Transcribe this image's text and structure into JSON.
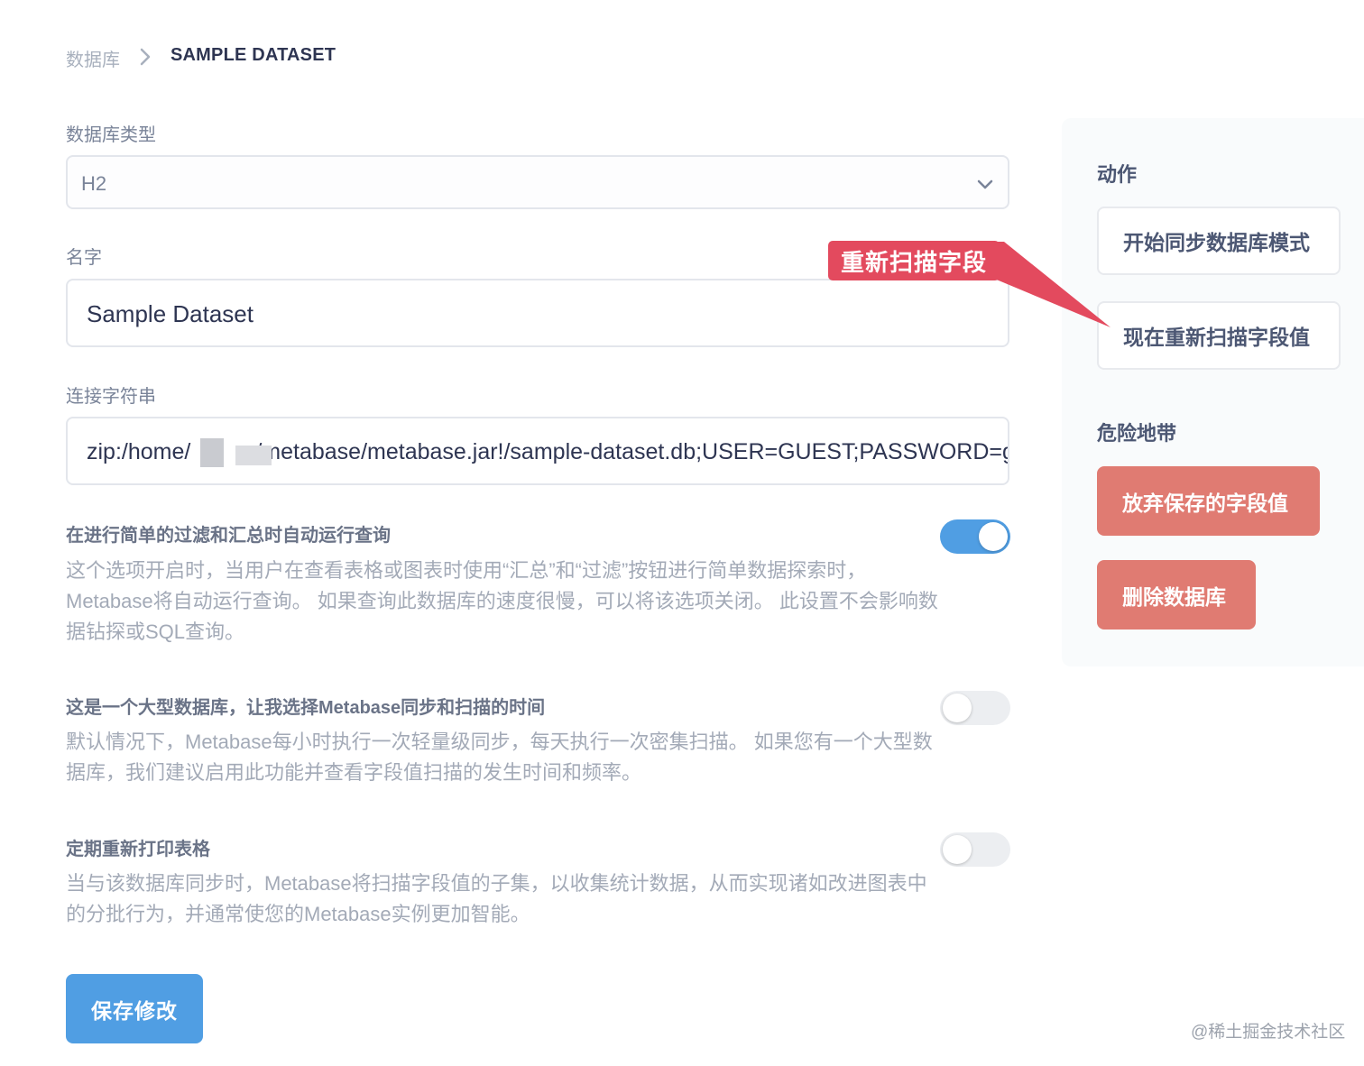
{
  "breadcrumb": {
    "root": "数据库",
    "current": "SAMPLE DATASET"
  },
  "form": {
    "db_type_label": "数据库类型",
    "db_type_value": "H2",
    "name_label": "名字",
    "name_value": "Sample Dataset",
    "conn_label": "连接字符串",
    "conn_value_prefix": "zip:/home/",
    "conn_value_suffix": "/metabase/metabase.jar!/sample-dataset.db;USER=GUEST;PASSWORD=guest"
  },
  "options": [
    {
      "title": "在进行简单的过滤和汇总时自动运行查询",
      "description": "这个选项开启时，当用户在查看表格或图表时使用“汇总”和“过滤”按钮进行简单数据探索时，Metabase将自动运行查询。 如果查询此数据库的速度很慢，可以将该选项关闭。 此设置不会影响数据钻探或SQL查询。",
      "enabled": true
    },
    {
      "title": "这是一个大型数据库，让我选择Metabase同步和扫描的时间",
      "description": "默认情况下，Metabase每小时执行一次轻量级同步，每天执行一次密集扫描。 如果您有一个大型数据库，我们建议启用此功能并查看字段值扫描的发生时间和频率。",
      "enabled": false
    },
    {
      "title": "定期重新打印表格",
      "description": "当与该数据库同步时，Metabase将扫描字段值的子集，以收集统计数据，从而实现诸如改进图表中的分批行为，并通常使您的Metabase实例更加智能。",
      "enabled": false
    }
  ],
  "save_button": "保存修改",
  "sidebar": {
    "actions_title": "动作",
    "sync_button": "开始同步数据库模式",
    "rescan_button": "现在重新扫描字段值",
    "danger_title": "危险地带",
    "discard_button": "放弃保存的字段值",
    "delete_button": "删除数据库"
  },
  "annotation": {
    "label": "重新扫描字段",
    "color": "#e34a5e"
  },
  "watermark": "@稀土掘金技术社区",
  "colors": {
    "primary": "#509ee3",
    "danger": "#e07b72",
    "text_dark": "#2e3552"
  }
}
